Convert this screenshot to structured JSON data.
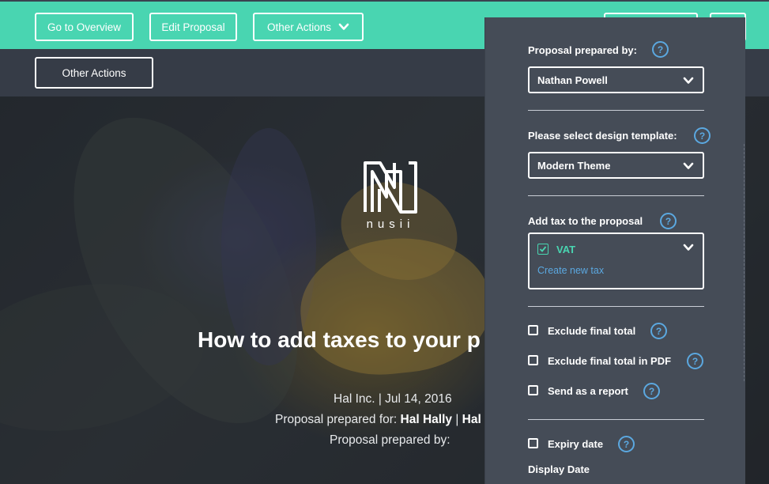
{
  "topbar": {
    "overview_label": "Go to Overview",
    "edit_label": "Edit Proposal",
    "other_actions_label": "Other Actions",
    "save_label": "",
    "close_label": ""
  },
  "subbar": {
    "other_actions_label": "Other Actions"
  },
  "hero": {
    "logo_text": "nusii",
    "title": "How to add taxes to your p",
    "company_line": "Hal Inc. | Jul 14, 2016",
    "prepared_for_prefix": "Proposal prepared for: ",
    "prepared_for_name": "Hal Hally",
    "prepared_for_sep": " | ",
    "prepared_for_company": "Hal",
    "prepared_by_line": "Proposal prepared by:"
  },
  "panel": {
    "prepared_by_title": "Proposal prepared by:",
    "prepared_by_value": "Nathan Powell",
    "template_title": "Please select design template:",
    "template_value": "Modern Theme",
    "tax_title": "Add tax to the proposal",
    "tax_name": "VAT",
    "tax_link": "Create new tax",
    "exclude_final_label": "Exclude final total",
    "exclude_pdf_label": "Exclude final total in PDF",
    "send_report_label": "Send as a report",
    "expiry_label": "Expiry date",
    "display_date_label": "Display Date",
    "help_glyph": "?"
  },
  "colors": {
    "teal": "#49d5b1",
    "panel_bg": "#454c57",
    "help_blue": "#5ba8e0",
    "subbar": "#363c47"
  }
}
